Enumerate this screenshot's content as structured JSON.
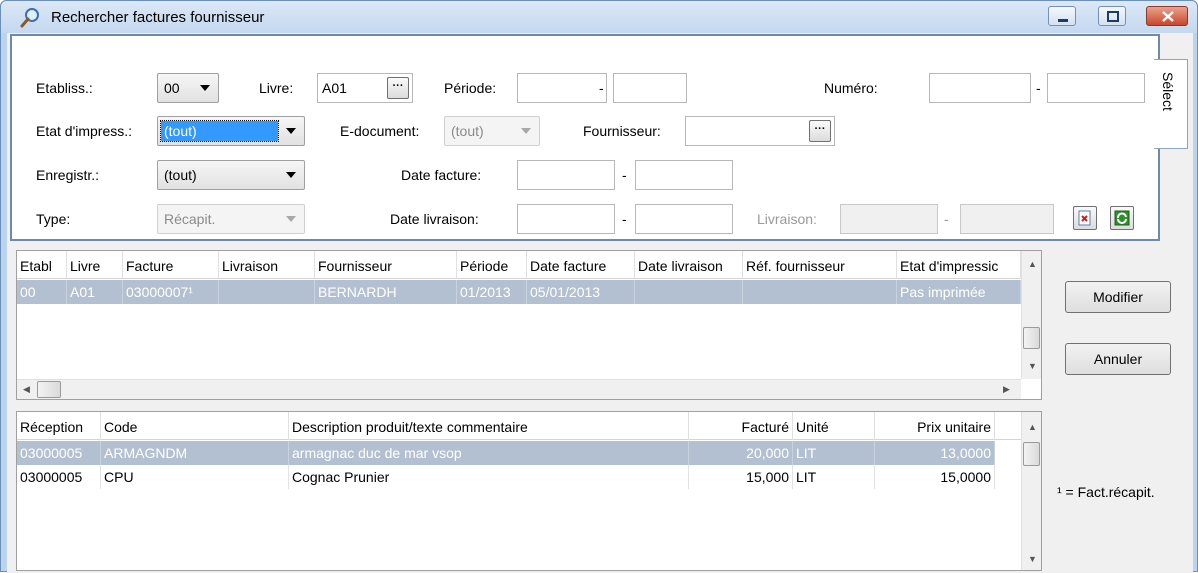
{
  "window": {
    "title": "Rechercher factures fournisseur"
  },
  "filters": {
    "etabliss_label": "Etabliss.:",
    "etabliss_value": "00",
    "livre_label": "Livre:",
    "livre_value": "A01",
    "periode_label": "Période:",
    "periode_from": "",
    "periode_sep": "-",
    "periode_to": "",
    "numero_label": "Numéro:",
    "numero_from": "",
    "numero_sep": "-",
    "numero_to": "",
    "etat_label": "Etat d'impress.:",
    "etat_value": "(tout)",
    "edoc_label": "E-document:",
    "edoc_value": "(tout)",
    "fournisseur_label": "Fournisseur:",
    "fournisseur_value": "",
    "enregistr_label": "Enregistr.:",
    "enregistr_value": "(tout)",
    "date_facture_label": "Date facture:",
    "date_facture_from": "",
    "date_facture_sep": "-",
    "date_facture_to": "",
    "type_label": "Type:",
    "type_value": "Récapit.",
    "date_livraison_label": "Date livraison:",
    "date_livraison_from": "",
    "date_livraison_sep": "-",
    "date_livraison_to": "",
    "livraison_label": "Livraison:",
    "livraison_from": "",
    "livraison_sep": "-",
    "livraison_to": "",
    "ellipsis": "···",
    "tab_select": "Sélect"
  },
  "invoices": {
    "columns": [
      "Etabl",
      "Livre",
      "Facture",
      "Livraison",
      "Fournisseur",
      "Période",
      "Date facture",
      "Date livraison",
      "Réf. fournisseur",
      "Etat d'impressic"
    ],
    "rows": [
      {
        "etabl": "00",
        "livre": "A01",
        "facture": "03000007¹",
        "livraison": "",
        "fournisseur": "BERNARDH",
        "periode": "01/2013",
        "date_facture": "05/01/2013",
        "date_livraison": "",
        "ref": "",
        "etat": "Pas imprimée"
      }
    ]
  },
  "lines": {
    "columns": [
      "Réception",
      "Code",
      "Description produit/texte commentaire",
      "Facturé",
      "Unité",
      "Prix unitaire"
    ],
    "rows": [
      {
        "reception": "03000005",
        "code": "ARMAGNDM",
        "description": "armagnac duc de mar vsop",
        "facture": "20,000",
        "unite": "LIT",
        "prix": "13,0000"
      },
      {
        "reception": "03000005",
        "code": "CPU",
        "description": "Cognac Prunier",
        "facture": "15,000",
        "unite": "LIT",
        "prix": "15,0000"
      }
    ]
  },
  "actions": {
    "modifier": "Modifier",
    "annuler": "Annuler"
  },
  "footnote": "¹ = Fact.récapit.",
  "icons": {
    "title": "magnifier-icon",
    "clear": "clear-filter-icon",
    "refresh": "refresh-icon"
  },
  "colors": {
    "selection": "#b3c0d1",
    "focus": "#3399ff",
    "frame": "#bcd3ec"
  }
}
